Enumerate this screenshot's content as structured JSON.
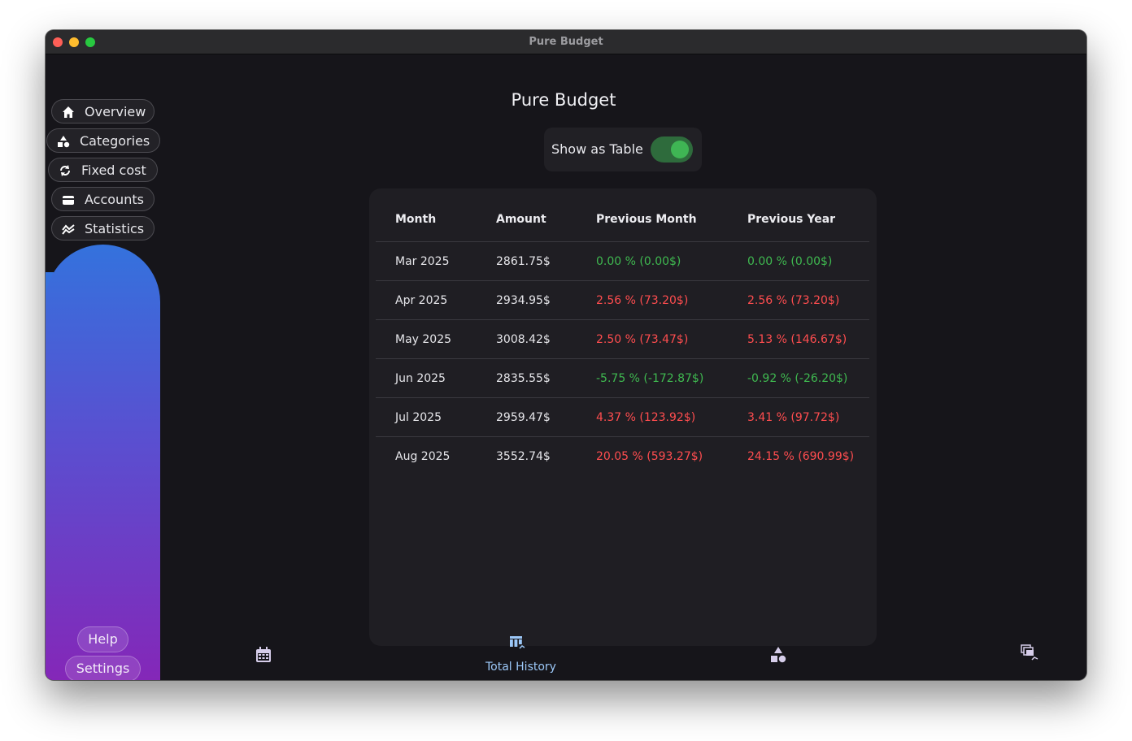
{
  "window": {
    "title": "Pure Budget"
  },
  "app": {
    "title": "Pure Budget"
  },
  "sidebar": {
    "items": [
      {
        "label": "Overview",
        "icon": "home-icon"
      },
      {
        "label": "Categories",
        "icon": "shapes-icon"
      },
      {
        "label": "Fixed cost",
        "icon": "sync-icon"
      },
      {
        "label": "Accounts",
        "icon": "wallet-icon"
      },
      {
        "label": "Statistics",
        "icon": "stats-icon"
      }
    ],
    "help": "Help",
    "settings": "Settings"
  },
  "toggle": {
    "label": "Show as Table",
    "on": true
  },
  "table": {
    "headers": [
      "Month",
      "Amount",
      "Previous Month",
      "Previous Year"
    ],
    "rows": [
      {
        "month": "Mar 2025",
        "amount": "2861.75$",
        "prev_month": "0.00 % (0.00$)",
        "prev_month_status": "green",
        "prev_year": "0.00 % (0.00$)",
        "prev_year_status": "green"
      },
      {
        "month": "Apr 2025",
        "amount": "2934.95$",
        "prev_month": "2.56 % (73.20$)",
        "prev_month_status": "red",
        "prev_year": "2.56 % (73.20$)",
        "prev_year_status": "red"
      },
      {
        "month": "May 2025",
        "amount": "3008.42$",
        "prev_month": "2.50 % (73.47$)",
        "prev_month_status": "red",
        "prev_year": "5.13 % (146.67$)",
        "prev_year_status": "red"
      },
      {
        "month": "Jun 2025",
        "amount": "2835.55$",
        "prev_month": "-5.75 % (-172.87$)",
        "prev_month_status": "green",
        "prev_year": "-0.92 % (-26.20$)",
        "prev_year_status": "green"
      },
      {
        "month": "Jul 2025",
        "amount": "2959.47$",
        "prev_month": "4.37 % (123.92$)",
        "prev_month_status": "red",
        "prev_year": "3.41 % (97.72$)",
        "prev_year_status": "red"
      },
      {
        "month": "Aug 2025",
        "amount": "3552.74$",
        "prev_month": "20.05 % (593.27$)",
        "prev_month_status": "red",
        "prev_year": "24.15 % (690.99$)",
        "prev_year_status": "red"
      }
    ]
  },
  "bottom_nav": {
    "items": [
      {
        "icon": "calendar-icon"
      },
      {
        "icon": "table-history-icon",
        "label": "Total History",
        "active": true
      },
      {
        "icon": "shapes-icon"
      },
      {
        "icon": "stacked-table-icon"
      }
    ]
  },
  "colors": {
    "positive": "#3fb950",
    "negative": "#ff4d4f",
    "active_tab": "#9cc8f8"
  }
}
